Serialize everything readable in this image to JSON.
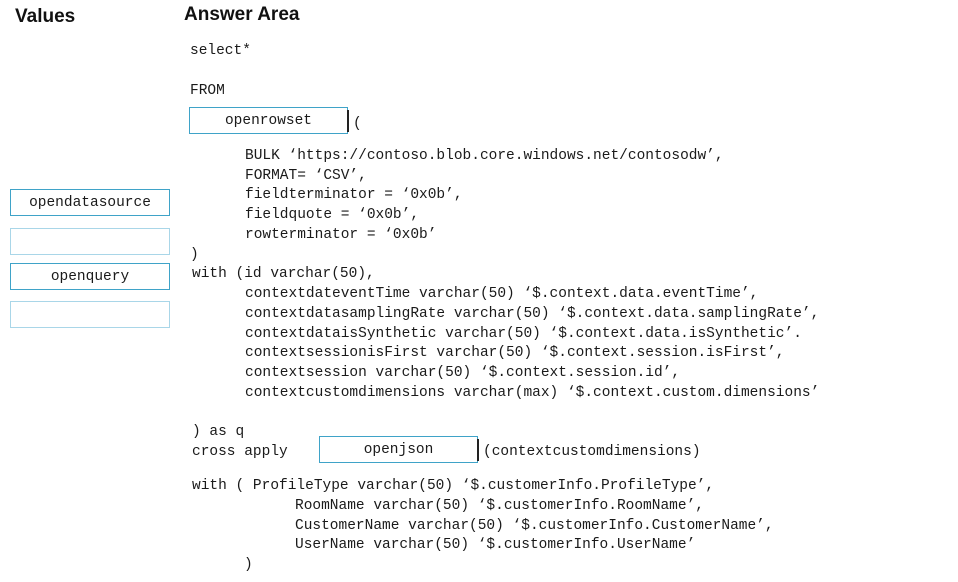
{
  "values_panel": {
    "title": "Values",
    "items": [
      "opendatasource",
      "",
      "openquery",
      ""
    ]
  },
  "answer_area": {
    "title": "Answer Area",
    "line_select": "select*",
    "line_from": "FROM",
    "slot1": "openrowset",
    "after_slot1": "(",
    "bulk_block": [
      "BULK ‘https://contoso.blob.core.windows.net/contosodw’,",
      "FORMAT= ‘CSV’,",
      "fieldterminator = ‘0x0b’,",
      "fieldquote = ‘0x0b’,",
      "rowterminator = ‘0x0b’"
    ],
    "close_paren": ")",
    "with_line": "with (id varchar(50),",
    "with_columns": [
      "contextdateventTime varchar(50) ‘$.context.data.eventTime’,",
      "contextdatasamplingRate varchar(50) ‘$.context.data.samplingRate’,",
      "contextdataisSynthetic varchar(50) ‘$.context.data.isSynthetic’.",
      "contextsessionisFirst varchar(50) ‘$.context.session.isFirst’,",
      "contextsession varchar(50) ‘$.context.session.id’,",
      "contextcustomdimensions varchar(max) ‘$.context.custom.dimensions’"
    ],
    "as_q": ") as q",
    "cross_apply": "cross apply",
    "slot2": "openjson",
    "after_slot2": "(contextcustomdimensions)",
    "with2_line": "with ( ProfileType varchar(50) ‘$.customerInfo.ProfileType’,",
    "with2_columns": [
      "RoomName varchar(50) ‘$.customerInfo.RoomName’,",
      "CustomerName varchar(50) ‘$.customerInfo.CustomerName’,",
      "UserName varchar(50) ‘$.customerInfo.UserName’"
    ],
    "final_paren": ")"
  }
}
